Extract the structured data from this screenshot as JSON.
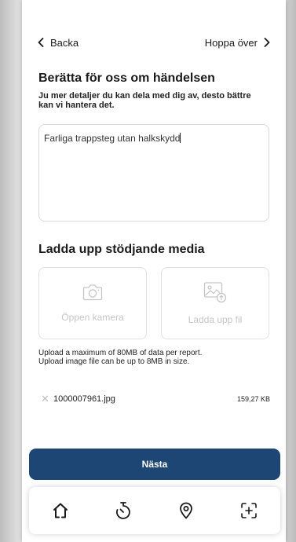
{
  "header": {
    "back_label": "Backa",
    "skip_label": "Hoppa över"
  },
  "description": {
    "title": "Berätta för oss om händelsen",
    "subtitle": "Ju mer detaljer du kan dela med dig av, desto bättre kan vi hantera det.",
    "text_value": "Farliga trappsteg utan halkskydd"
  },
  "media": {
    "title": "Ladda upp stödjande media",
    "camera_label": "Öppen kamera",
    "camera_icon": "camera-icon",
    "upload_label": "Ladda upp fil",
    "upload_icon": "image-upload-icon",
    "limit_line1": "Upload a maximum of 80MB of data per report.",
    "limit_line2": "Upload image file can be up to 8MB in size."
  },
  "files": [
    {
      "name": "1000007961.jpg",
      "size": "159,27 KB",
      "remove_icon": "close-icon"
    }
  ],
  "next_label": "Nästa",
  "bottom_nav": [
    {
      "icon": "home-icon"
    },
    {
      "icon": "stopwatch-icon"
    },
    {
      "icon": "location-pin-icon"
    },
    {
      "icon": "scan-add-icon"
    }
  ],
  "colors": {
    "primary": "#1e4674",
    "disabled": "#c6c6c6"
  }
}
